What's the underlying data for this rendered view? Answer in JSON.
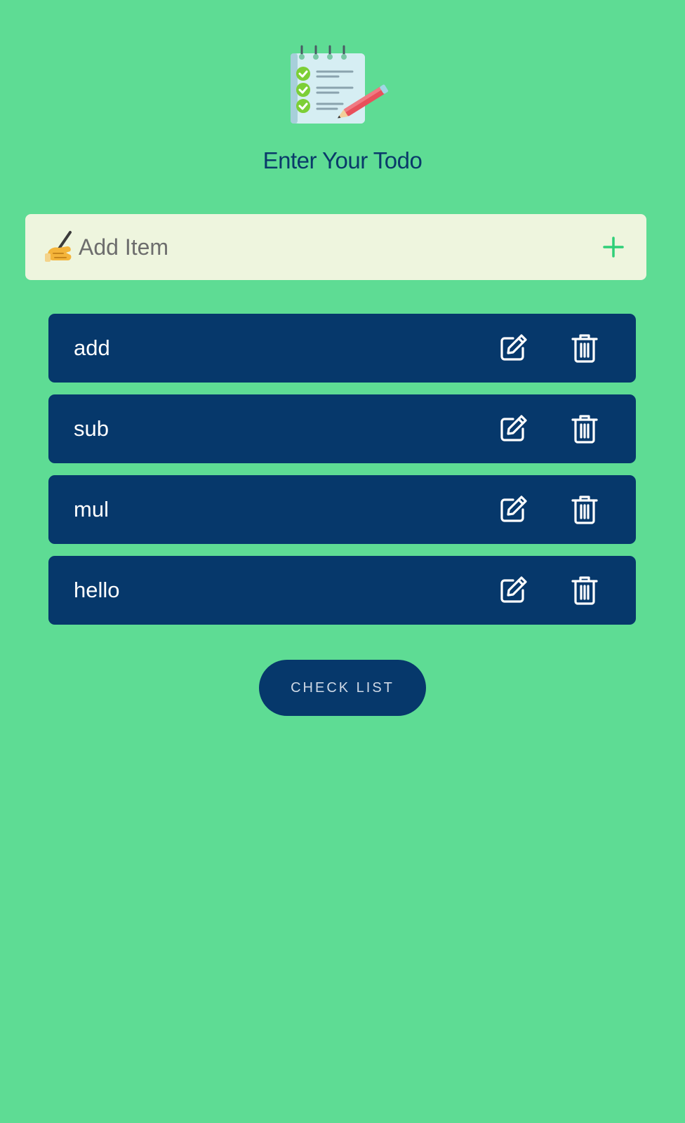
{
  "header": {
    "logo_icon": "notepad-checklist-icon",
    "title": "Enter Your Todo"
  },
  "add_item": {
    "icon": "writing-hand-icon",
    "placeholder": "Add Item",
    "value": "",
    "add_icon": "plus-icon",
    "accent_color": "#2fcf78"
  },
  "todos": {
    "items": [
      {
        "label": "add",
        "edit_icon": "edit-icon",
        "delete_icon": "trash-icon"
      },
      {
        "label": "sub",
        "edit_icon": "edit-icon",
        "delete_icon": "trash-icon"
      },
      {
        "label": "mul",
        "edit_icon": "edit-icon",
        "delete_icon": "trash-icon"
      },
      {
        "label": "hello",
        "edit_icon": "edit-icon",
        "delete_icon": "trash-icon"
      }
    ]
  },
  "actions": {
    "check_list_label": "CHECK LIST"
  },
  "colors": {
    "background": "#5edc94",
    "card": "#06386b",
    "title": "#0a3a6a",
    "input_bg": "#eef5de"
  }
}
